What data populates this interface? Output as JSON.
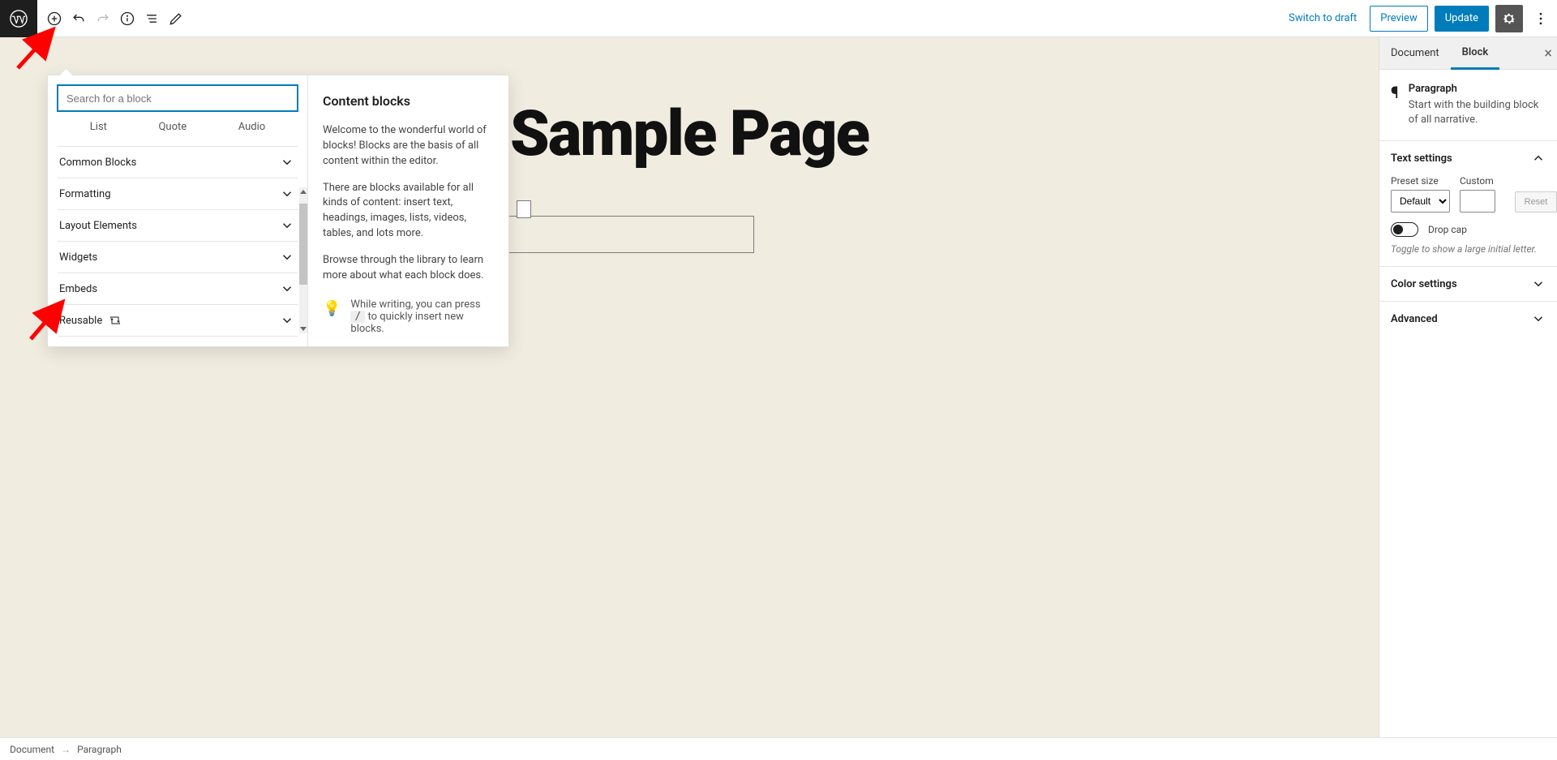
{
  "topbar": {
    "switch_draft": "Switch to draft",
    "preview": "Preview",
    "update": "Update"
  },
  "inserter": {
    "search_placeholder": "Search for a block",
    "tabs": {
      "list": "List",
      "quote": "Quote",
      "audio": "Audio"
    },
    "categories": {
      "common": "Common Blocks",
      "formatting": "Formatting",
      "layout": "Layout Elements",
      "widgets": "Widgets",
      "embeds": "Embeds",
      "reusable": "Reusable"
    },
    "info": {
      "title": "Content blocks",
      "p1": "Welcome to the wonderful world of blocks! Blocks are the basis of all content within the editor.",
      "p2": "There are blocks available for all kinds of content: insert text, headings, images, lists, videos, tables, and lots more.",
      "p3": "Browse through the library to learn more about what each block does."
    },
    "tip": {
      "pre": "While writing, you can press ",
      "key": "/",
      "post": " to quickly insert new blocks."
    }
  },
  "canvas": {
    "page_title": "Sample Page"
  },
  "sidebar": {
    "tabs": {
      "document": "Document",
      "block": "Block"
    },
    "block": {
      "title": "Paragraph",
      "desc": "Start with the building block of all narrative."
    },
    "panels": {
      "text": "Text settings",
      "color": "Color settings",
      "advanced": "Advanced"
    },
    "text_settings": {
      "preset_label": "Preset size",
      "preset_value": "Default",
      "custom_label": "Custom",
      "reset": "Reset",
      "dropcap_label": "Drop cap",
      "dropcap_hint": "Toggle to show a large initial letter."
    }
  },
  "footer": {
    "document": "Document",
    "paragraph": "Paragraph"
  }
}
